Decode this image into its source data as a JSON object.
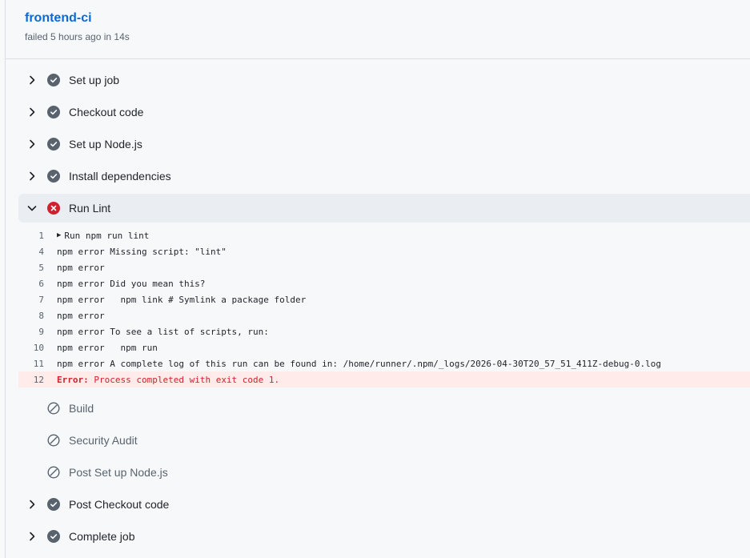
{
  "job": {
    "title": "frontend-ci",
    "subtitle": "failed 5 hours ago in 14s"
  },
  "steps_before": [
    {
      "label": "Set up job",
      "status": "success"
    },
    {
      "label": "Checkout code",
      "status": "success"
    },
    {
      "label": "Set up Node.js",
      "status": "success"
    },
    {
      "label": "Install dependencies",
      "status": "success"
    }
  ],
  "active_step": {
    "label": "Run Lint",
    "status": "failure"
  },
  "log": [
    {
      "num": "1",
      "text": "Run npm run lint",
      "group": true
    },
    {
      "num": "4",
      "text": "npm error Missing script: \"lint\""
    },
    {
      "num": "5",
      "text": "npm error"
    },
    {
      "num": "6",
      "text": "npm error Did you mean this?"
    },
    {
      "num": "7",
      "text": "npm error   npm link # Symlink a package folder"
    },
    {
      "num": "8",
      "text": "npm error"
    },
    {
      "num": "9",
      "text": "npm error To see a list of scripts, run:"
    },
    {
      "num": "10",
      "text": "npm error   npm run"
    },
    {
      "num": "11",
      "text": "npm error A complete log of this run can be found in: /home/runner/.npm/_logs/2026-04-30T20_57_51_411Z-debug-0.log"
    }
  ],
  "error_line": {
    "num": "12",
    "label": "Error:",
    "text": " Process completed with exit code 1."
  },
  "steps_after": [
    {
      "label": "Build",
      "status": "skipped"
    },
    {
      "label": "Security Audit",
      "status": "skipped"
    },
    {
      "label": "Post Set up Node.js",
      "status": "skipped"
    },
    {
      "label": "Post Checkout code",
      "status": "success"
    },
    {
      "label": "Complete job",
      "status": "success"
    }
  ],
  "colors": {
    "success": "#59636e",
    "failure": "#cf222e",
    "link": "#0969da"
  }
}
